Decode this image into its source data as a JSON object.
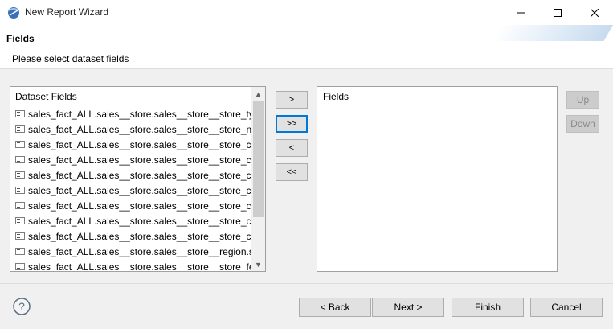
{
  "window": {
    "title": "New Report Wizard",
    "icon": "eclipse-app-icon"
  },
  "header": {
    "title": "Fields",
    "description": "Please select dataset fields"
  },
  "dataset_list": {
    "header": "Dataset Fields",
    "items": [
      "sales_fact_ALL.sales__store.sales__store__store_type",
      "sales_fact_ALL.sales__store.sales__store__store_name",
      "sales_fact_ALL.sales__store.sales__store__store_con...",
      "sales_fact_ALL.sales__store.sales__store__store_con...",
      "sales_fact_ALL.sales__store.sales__store__store_con...",
      "sales_fact_ALL.sales__store.sales__store__store_con...",
      "sales_fact_ALL.sales__store.sales__store__store_con...",
      "sales_fact_ALL.sales__store.sales__store__store_con...",
      "sales_fact_ALL.sales__store.sales__store__store_con...",
      "sales_fact_ALL.sales__store.sales__store__region.sal...",
      "sales_fact_ALL.sales__store.sales__store__store_feat..."
    ]
  },
  "move_buttons": {
    "add": ">",
    "add_all": ">>",
    "remove": "<",
    "remove_all": "<<"
  },
  "fields_list": {
    "header": "Fields"
  },
  "order_buttons": {
    "up": "Up",
    "down": "Down"
  },
  "footer": {
    "back": "< Back",
    "next": "Next >",
    "finish": "Finish",
    "cancel": "Cancel"
  }
}
